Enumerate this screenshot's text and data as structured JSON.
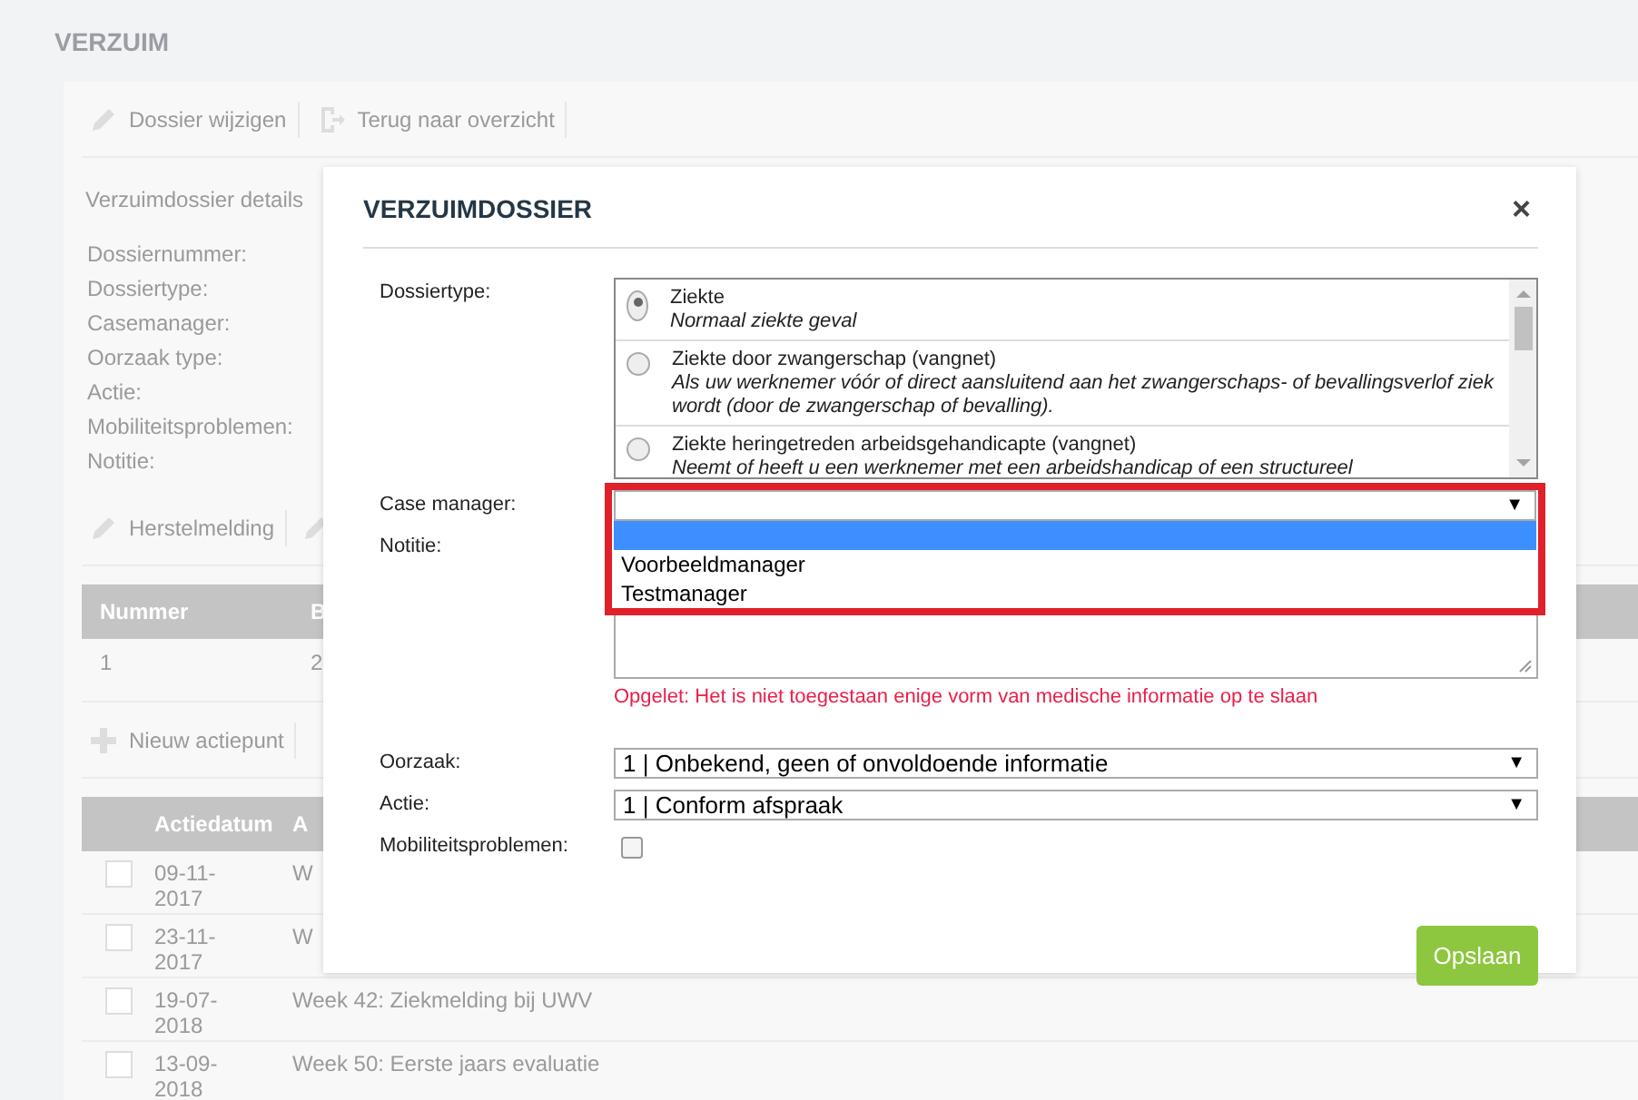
{
  "page": {
    "title": "VERZUIM",
    "toolbar": [
      "Dossier wijzigen",
      "Terug naar overzicht"
    ],
    "details_heading": "Verzuimdossier details",
    "detail_labels": [
      "Dossiernummer:",
      "Dossiertype:",
      "Casemanager:",
      "Oorzaak type:",
      "Actie:",
      "Mobiliteitsproblemen:",
      "Notitie:"
    ],
    "toolbar_2": [
      "Herstelmelding"
    ],
    "table_1": {
      "columns": [
        "Nummer",
        "B"
      ],
      "rows": [
        [
          "1",
          "2"
        ]
      ]
    },
    "add_button": "Nieuw actiepunt",
    "table_2": {
      "columns": [
        "Actiedatum",
        "A"
      ],
      "rows": [
        {
          "checked": false,
          "cells": [
            "09-11-2017",
            "W"
          ]
        },
        {
          "checked": false,
          "cells": [
            "23-11-2017",
            "W"
          ]
        },
        {
          "checked": false,
          "cells": [
            "19-07-2018",
            "Week 42: Ziekmelding bij UWV"
          ]
        },
        {
          "checked": false,
          "cells": [
            "13-09-2018",
            "Week 50: Eerste jaars evaluatie"
          ]
        }
      ]
    }
  },
  "dialog": {
    "title": "VERZUIMDOSSIER",
    "close": "×",
    "dossiertype": {
      "label": "Dossiertype:",
      "options": [
        {
          "title": "Ziekte",
          "description": "Normaal ziekte geval",
          "selected": true
        },
        {
          "title": "Ziekte door zwangerschap (vangnet)",
          "description": "Als uw werknemer vóór of direct aansluitend aan het zwangerschaps- of bevallingsverlof ziek wordt (door de zwangerschap of bevalling).",
          "selected": false
        },
        {
          "title": "Ziekte heringetreden arbeidsgehandicapte (vangnet)",
          "description": "Neemt of heeft u een werknemer met een arbeidshandicap of een structureel",
          "selected": false
        }
      ]
    },
    "case_manager": {
      "label": "Case manager:",
      "caret": "▼",
      "expanded": true,
      "options": [
        {
          "selected": true
        },
        {
          "label": "Voorbeeldmanager",
          "selected": false
        },
        {
          "label": "Testmanager",
          "selected": false
        }
      ]
    },
    "notitie": {
      "label": "Notitie:",
      "warning": "Opgelet: Het is niet toegestaan enige vorm van medische informatie op te slaan"
    },
    "oorzaak": {
      "label": "Oorzaak:",
      "value": "1 | Onbekend, geen of onvoldoende informatie",
      "caret": "▼"
    },
    "actie": {
      "label": "Actie:",
      "value": "1 | Conform afspraak",
      "caret": "▼"
    },
    "mobiliteit": {
      "label": "Mobiliteitsproblemen:",
      "checked": false
    },
    "save": "Opslaan"
  }
}
